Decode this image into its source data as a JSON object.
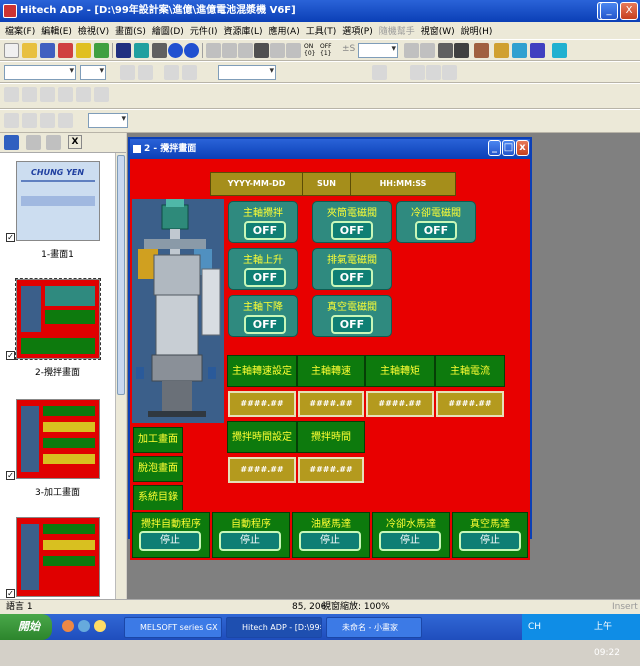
{
  "app": {
    "title": "Hitech ADP - [D:\\99年設計案\\進億\\進億電池混漿機 V6F]",
    "window_buttons": [
      "_",
      "□",
      "X"
    ]
  },
  "menu": [
    "檔案(F)",
    "編輯(E)",
    "檢視(V)",
    "畫面(S)",
    "繪圖(D)",
    "元件(I)",
    "資源庫(L)",
    "應用(A)",
    "工具(T)",
    "選項(P)",
    "隨機幫手",
    "視窗(W)",
    "說明(H)"
  ],
  "toolbar": {
    "onoff_on": "ON",
    "onoff_off": "OFF",
    "signal": "±S"
  },
  "left_panel": {
    "close_label": "X",
    "thumbnails": [
      {
        "label": "1-畫面1",
        "checked": true,
        "brand": "CHUNG YEN"
      },
      {
        "label": "2-攪拌畫面",
        "checked": true
      },
      {
        "label": "3-加工畫面",
        "checked": true
      },
      {
        "label": "",
        "checked": true
      }
    ]
  },
  "child_window": {
    "title": "2 - 攪拌畫面"
  },
  "screen": {
    "date": "YYYY-MM-DD",
    "day": "SUN",
    "time": "HH:MM:SS",
    "toggles": [
      {
        "label": "主軸攪拌",
        "state": "OFF"
      },
      {
        "label": "夾筒電磁閥",
        "state": "OFF"
      },
      {
        "label": "冷卻電磁閥",
        "state": "OFF"
      },
      {
        "label": "主軸上升",
        "state": "OFF"
      },
      {
        "label": "排氣電磁閥",
        "state": "OFF"
      },
      {
        "label": "主軸下降",
        "state": "OFF"
      },
      {
        "label": "真空電磁閥",
        "state": "OFF"
      }
    ],
    "readouts_row1": [
      {
        "label": "主軸轉速設定",
        "value": "####.##"
      },
      {
        "label": "主軸轉速",
        "value": "####.##"
      },
      {
        "label": "主軸轉矩",
        "value": "####.##"
      },
      {
        "label": "主軸電流",
        "value": "####.##"
      }
    ],
    "readouts_row2": [
      {
        "label": "攪拌時間設定",
        "value": "####.##"
      },
      {
        "label": "攪拌時間",
        "value": "####.##"
      }
    ],
    "nav": [
      "加工畫面",
      "脫泡畫面",
      "系統目錄"
    ],
    "bottom": [
      {
        "label": "攪拌自動程序",
        "button": "停止"
      },
      {
        "label": "自動程序",
        "button": "停止"
      },
      {
        "label": "油壓馬達",
        "button": "停止"
      },
      {
        "label": "冷卻水馬達",
        "button": "停止"
      },
      {
        "label": "真空馬達",
        "button": "停止"
      }
    ]
  },
  "statusbar": {
    "lang": "語言 1",
    "coords": "85, 206",
    "zoom": "視窗縮放: 100%",
    "mode": "Insert"
  },
  "taskbar": {
    "start": "開始",
    "tasks": [
      "MELSOFT series GX ...",
      "Hitech ADP - [D:\\99年...",
      "未命名 - 小畫家"
    ],
    "tray_lang": "CH",
    "clock": "上午 09:22"
  }
}
